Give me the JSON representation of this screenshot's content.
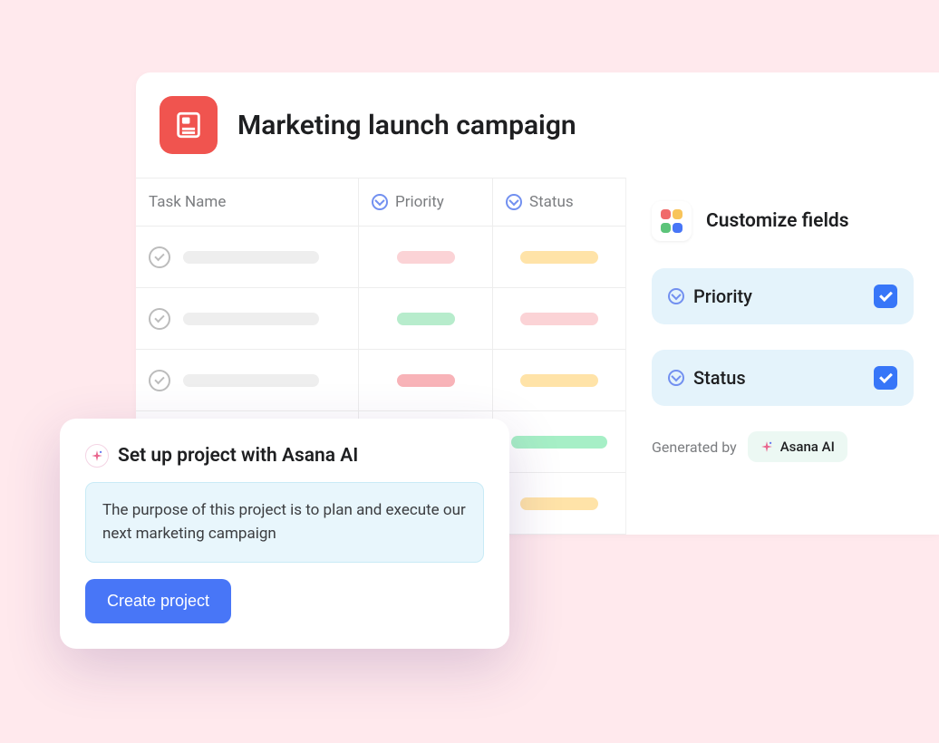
{
  "project": {
    "title": "Marketing launch campaign"
  },
  "columns": {
    "task_name": "Task Name",
    "priority": "Priority",
    "status": "Status"
  },
  "customize": {
    "title": "Customize fields",
    "field_priority": "Priority",
    "field_status": "Status",
    "generated_by": "Generated by",
    "ai_label": "Asana AI"
  },
  "ai_popup": {
    "title": "Set up project with Asana AI",
    "prompt": "The purpose of this project is to plan and execute our next marketing campaign",
    "button": "Create project"
  }
}
